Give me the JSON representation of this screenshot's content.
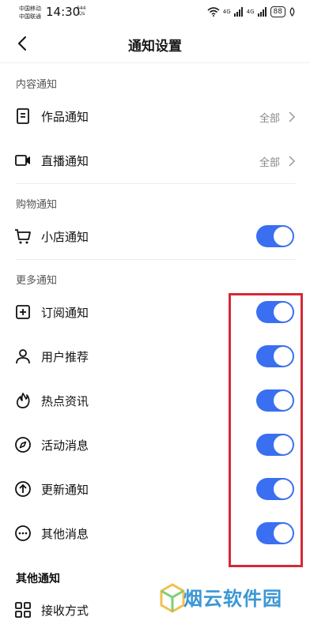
{
  "status": {
    "carrier1": "中国移动",
    "carrier2": "中国联通",
    "time": "14:30",
    "speed_value": "644",
    "speed_unit": "K/s",
    "net1": "4G",
    "net2": "4G",
    "battery": "88"
  },
  "header": {
    "title": "通知设置"
  },
  "sections": {
    "content": "内容通知",
    "shopping": "购物通知",
    "more": "更多通知",
    "other": "其他通知"
  },
  "rows": {
    "works": {
      "label": "作品通知",
      "value": "全部",
      "icon": "document-icon"
    },
    "live": {
      "label": "直播通知",
      "value": "全部",
      "icon": "video-camera-icon"
    },
    "shop": {
      "label": "小店通知",
      "toggle": true,
      "icon": "cart-icon"
    },
    "subscribe": {
      "label": "订阅通知",
      "toggle": true,
      "icon": "plus-square-icon"
    },
    "recommend": {
      "label": "用户推荐",
      "toggle": true,
      "icon": "person-icon"
    },
    "hot": {
      "label": "热点资讯",
      "toggle": true,
      "icon": "flame-icon"
    },
    "activity": {
      "label": "活动消息",
      "toggle": true,
      "icon": "compass-icon"
    },
    "update": {
      "label": "更新通知",
      "toggle": true,
      "icon": "arrow-up-circle-icon"
    },
    "othermsg": {
      "label": "其他消息",
      "toggle": true,
      "icon": "ellipsis-circle-icon"
    },
    "receive": {
      "label": "接收方式",
      "icon": "grid-icon"
    }
  },
  "colors": {
    "toggle_on": "#3a6ff2",
    "highlight": "#d42a36",
    "watermark": "#3b97d5"
  },
  "watermark": {
    "text": "烟云软件园"
  }
}
